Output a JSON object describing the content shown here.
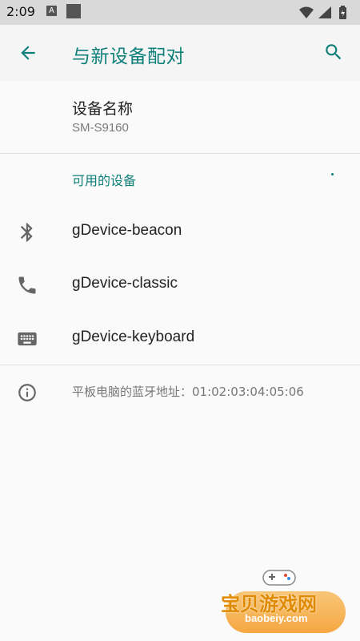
{
  "status_bar": {
    "time": "2:09",
    "left_icons": [
      "a-notification-icon",
      "square-notification-icon"
    ],
    "right_icons": [
      "wifi-icon",
      "signal-icon",
      "battery-icon"
    ]
  },
  "app_bar": {
    "title": "与新设备配对",
    "back_icon": "arrow-back-icon",
    "search_icon": "search-icon",
    "accent_color": "#0d7f79"
  },
  "device_name": {
    "label": "设备名称",
    "value": "SM-S9160"
  },
  "available_devices": {
    "header": "可用的设备",
    "items": [
      {
        "label": "gDevice-beacon",
        "icon": "bluetooth-icon"
      },
      {
        "label": "gDevice-classic",
        "icon": "phone-icon"
      },
      {
        "label": "gDevice-keyboard",
        "icon": "keyboard-icon"
      }
    ]
  },
  "info": {
    "text": "平板电脑的蓝牙地址：01:02:03:04:05:06",
    "icon": "info-icon"
  },
  "watermark": {
    "title": "宝贝游戏网",
    "subtitle": "baobeiy.com"
  }
}
